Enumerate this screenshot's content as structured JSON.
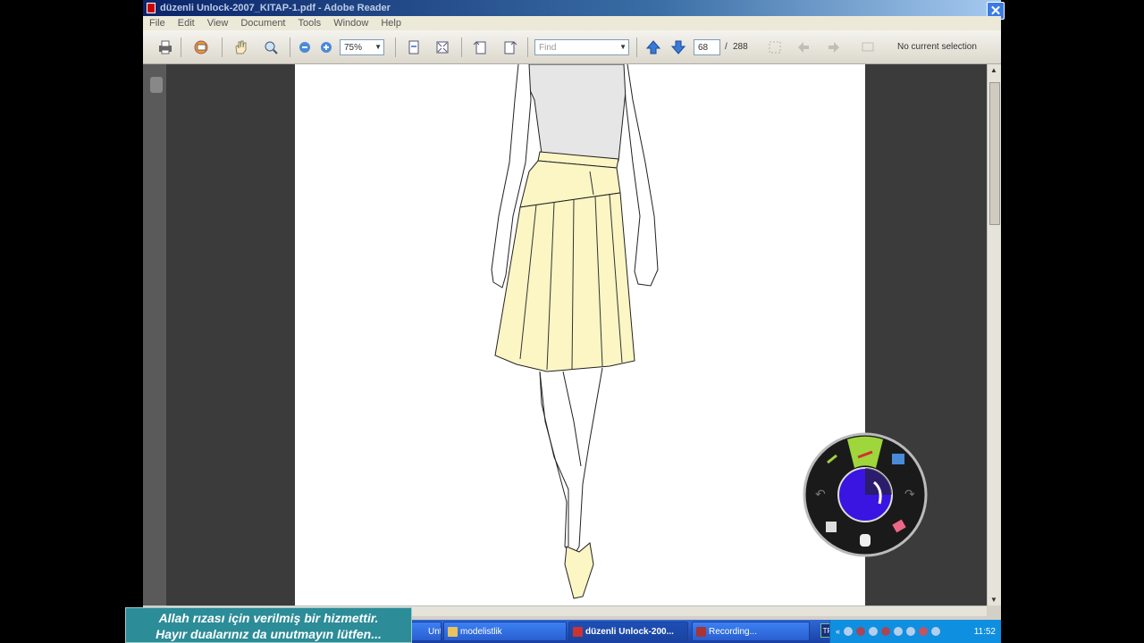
{
  "window": {
    "title": "düzenli Unlock-2007_KITAP-1.pdf - Adobe Reader",
    "close_glyph": "✕"
  },
  "menu": [
    "File",
    "Edit",
    "View",
    "Document",
    "Tools",
    "Window",
    "Help"
  ],
  "toolbar": {
    "zoom_value": "75%",
    "find_placeholder": "Find",
    "page_current": "68",
    "page_separator": "/",
    "page_total": "288",
    "selection_status": "No current selection"
  },
  "taskbar": {
    "items": [
      {
        "label": "Unt..."
      },
      {
        "label": "modelistlik"
      },
      {
        "label": "düzenli Unlock-200..."
      },
      {
        "label": "Recording..."
      }
    ],
    "language": "TR",
    "clock": "11:52"
  },
  "caption": {
    "line1": "Allah rızası için verilmiş bir hizmettir.",
    "line2": "Hayır dualarınız da unutmayın lütfen..."
  },
  "colors": {
    "skirt_fill": "#fbf6c4",
    "top_fill": "#e6e6e6",
    "wheel_accent": "#9fd63b",
    "wheel_center": "#3a14e0"
  }
}
